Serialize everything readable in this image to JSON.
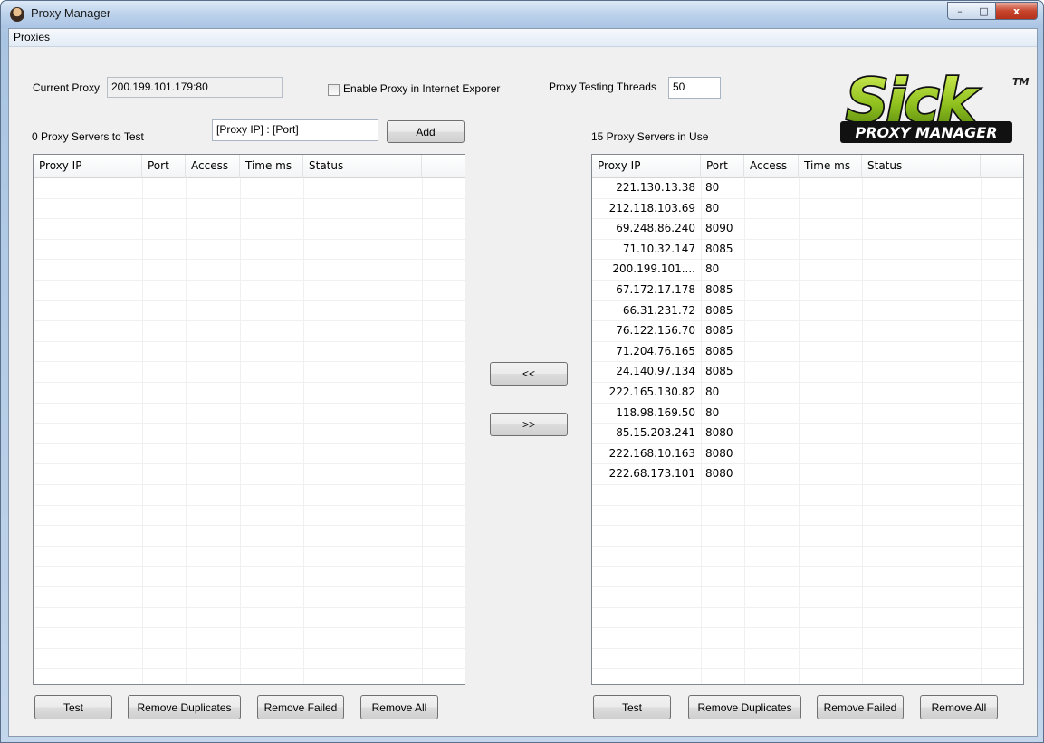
{
  "window": {
    "title": "Proxy Manager",
    "controls": {
      "minimize": "–",
      "maximize": "□",
      "close": "x"
    }
  },
  "menu": {
    "items": [
      "Proxies"
    ]
  },
  "settings": {
    "current_proxy_label": "Current Proxy",
    "current_proxy_value": "200.199.101.179:80",
    "enable_ie_label": "Enable Proxy in Internet Exporer",
    "enable_ie_checked": false,
    "threads_label": "Proxy Testing Threads",
    "threads_value": "50"
  },
  "logo": {
    "word": "Sick",
    "tagline": "PROXY MANAGER",
    "tm": "TM"
  },
  "left_panel": {
    "count_label": "0 Proxy Servers to Test",
    "add_input_value": "[Proxy IP] : [Port]",
    "add_button": "Add",
    "columns": [
      "Proxy IP",
      "Port",
      "Access",
      "Time ms",
      "Status"
    ],
    "rows": [],
    "buttons": {
      "test": "Test",
      "remove_duplicates": "Remove Duplicates",
      "remove_failed": "Remove Failed",
      "remove_all": "Remove All"
    }
  },
  "transfer": {
    "to_left": "<<",
    "to_right": ">>"
  },
  "right_panel": {
    "count_label": "15 Proxy Servers in Use",
    "columns": [
      "Proxy IP",
      "Port",
      "Access",
      "Time ms",
      "Status"
    ],
    "rows": [
      {
        "ip": "221.130.13.38",
        "port": "80"
      },
      {
        "ip": "212.118.103.69",
        "port": "80"
      },
      {
        "ip": "69.248.86.240",
        "port": "8090"
      },
      {
        "ip": "71.10.32.147",
        "port": "8085"
      },
      {
        "ip": "200.199.101....",
        "port": "80"
      },
      {
        "ip": "67.172.17.178",
        "port": "8085"
      },
      {
        "ip": "66.31.231.72",
        "port": "8085"
      },
      {
        "ip": "76.122.156.70",
        "port": "8085"
      },
      {
        "ip": "71.204.76.165",
        "port": "8085"
      },
      {
        "ip": "24.140.97.134",
        "port": "8085"
      },
      {
        "ip": "222.165.130.82",
        "port": "80"
      },
      {
        "ip": "118.98.169.50",
        "port": "80"
      },
      {
        "ip": "85.15.203.241",
        "port": "8080"
      },
      {
        "ip": "222.168.10.163",
        "port": "8080"
      },
      {
        "ip": "222.68.173.101",
        "port": "8080"
      }
    ],
    "buttons": {
      "test": "Test",
      "remove_duplicates": "Remove Duplicates",
      "remove_failed": "Remove Failed",
      "remove_all": "Remove All"
    }
  }
}
